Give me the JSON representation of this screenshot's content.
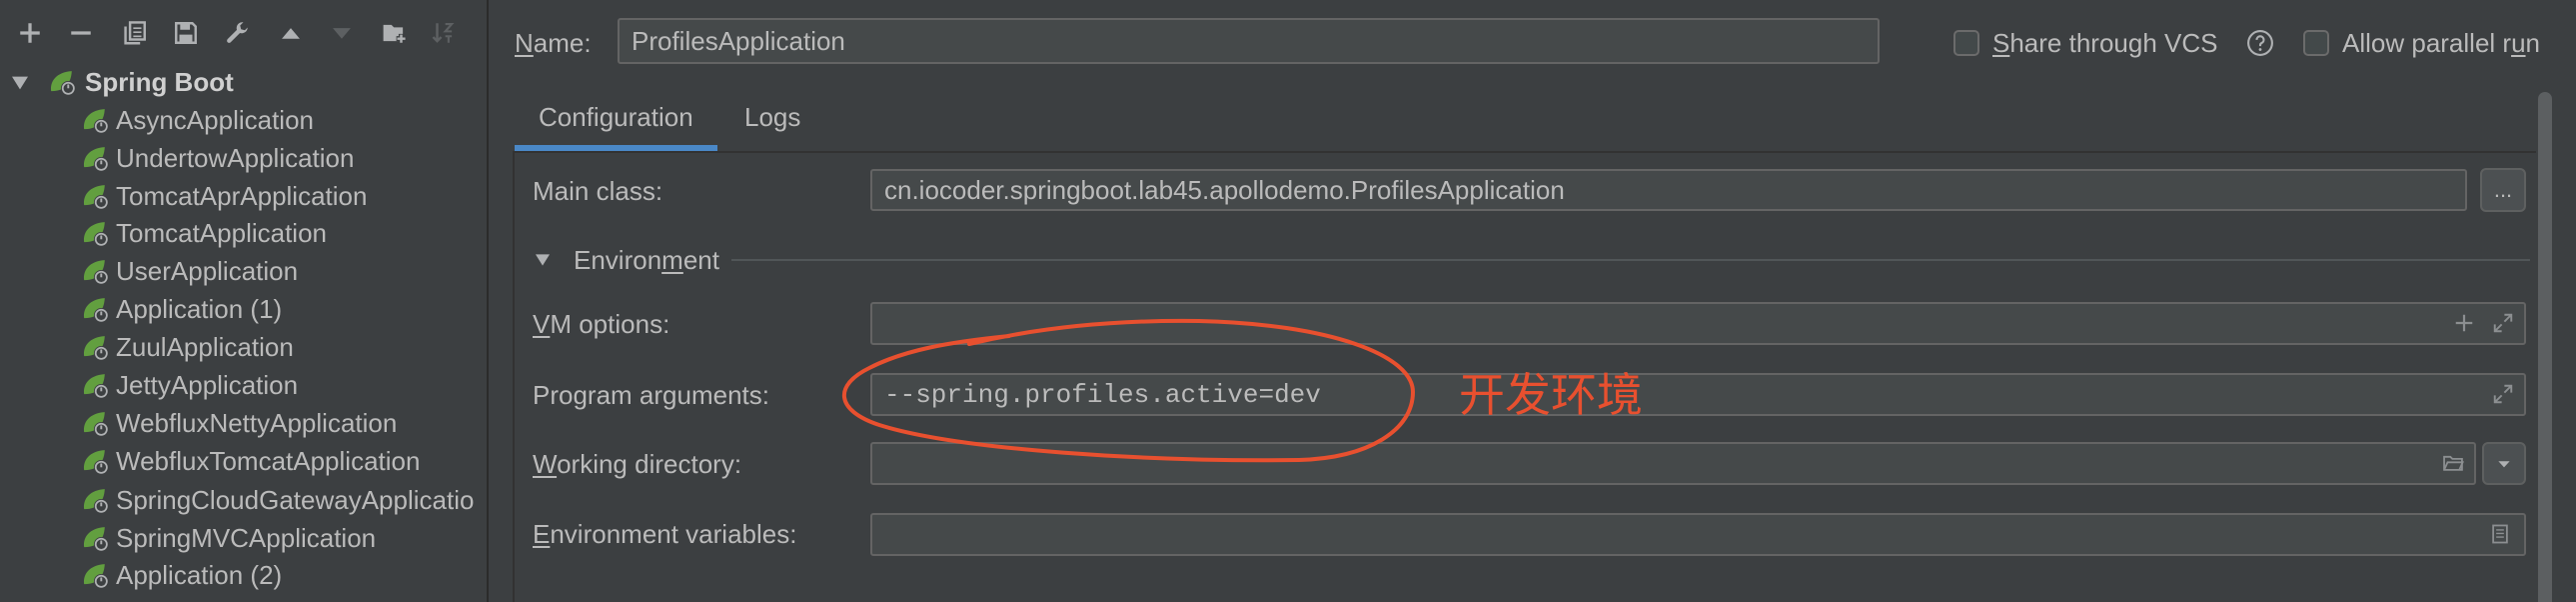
{
  "toolbar": {
    "buttons": [
      {
        "icon": "add-icon",
        "enabled": true
      },
      {
        "icon": "remove-icon",
        "enabled": true
      },
      {
        "icon": "copy-icon",
        "enabled": true
      },
      {
        "icon": "save-icon",
        "enabled": true
      },
      {
        "icon": "wrench-icon",
        "enabled": true
      },
      {
        "icon": "arrow-up-icon",
        "enabled": true
      },
      {
        "icon": "arrow-down-icon",
        "enabled": false
      },
      {
        "icon": "folder-plus-icon",
        "enabled": true
      },
      {
        "icon": "sort-icon",
        "enabled": false
      }
    ]
  },
  "tree": {
    "group": {
      "label": "Spring Boot",
      "icon": "spring-boot-icon",
      "expanded": true
    },
    "items": [
      {
        "label": "AsyncApplication",
        "icon": "spring-boot-icon"
      },
      {
        "label": "UndertowApplication",
        "icon": "spring-boot-icon"
      },
      {
        "label": "TomcatAprApplication",
        "icon": "spring-boot-icon"
      },
      {
        "label": "TomcatApplication",
        "icon": "spring-boot-icon"
      },
      {
        "label": "UserApplication",
        "icon": "spring-boot-icon"
      },
      {
        "label": "Application (1)",
        "icon": "spring-boot-icon"
      },
      {
        "label": "ZuulApplication",
        "icon": "spring-boot-icon"
      },
      {
        "label": "JettyApplication",
        "icon": "spring-boot-icon"
      },
      {
        "label": "WebfluxNettyApplication",
        "icon": "spring-boot-icon"
      },
      {
        "label": "WebfluxTomcatApplication",
        "icon": "spring-boot-icon"
      },
      {
        "label": "SpringCloudGatewayApplicatio",
        "icon": "spring-boot-icon"
      },
      {
        "label": "SpringMVCApplication",
        "icon": "spring-boot-icon"
      },
      {
        "label": "Application (2)",
        "icon": "spring-boot-icon"
      }
    ]
  },
  "name_field": {
    "label": "Name:",
    "value": "ProfilesApplication"
  },
  "share_vcs": {
    "label": "Share through VCS",
    "checked": false,
    "help_icon": "help-icon"
  },
  "allow_parallel_run": {
    "label": "Allow parallel run",
    "checked": false
  },
  "tabs": [
    {
      "label": "Configuration",
      "selected": true
    },
    {
      "label": "Logs",
      "selected": false
    }
  ],
  "main_class": {
    "label": "Main class:",
    "value": "cn.iocoder.springboot.lab45.apollodemo.ProfilesApplication",
    "browse_label": "..."
  },
  "environment": {
    "label": "Environment",
    "expanded": true
  },
  "vm_options": {
    "label": "VM options:",
    "value": ""
  },
  "program_arguments": {
    "label": "Program arguments:",
    "value": "--spring.profiles.active=dev"
  },
  "working_directory": {
    "label": "Working directory:",
    "value": ""
  },
  "environment_variables": {
    "label": "Environment variables:",
    "value": ""
  },
  "annotation": {
    "text": "开发环境"
  },
  "colors": {
    "accent": "#4a88c7",
    "annotation": "#e8502f",
    "spring_icon": "#629f3f"
  }
}
